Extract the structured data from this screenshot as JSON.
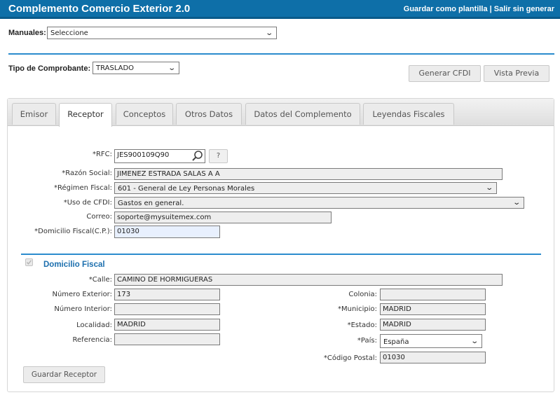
{
  "header": {
    "title": "Complemento Comercio Exterior 2.0",
    "save_template": "Guardar como plantilla",
    "separator": " | ",
    "exit": "Salir sin generar"
  },
  "manuales": {
    "label": "Manuales:",
    "value": "Seleccione"
  },
  "tipo_comprobante": {
    "label": "Tipo de Comprobante:",
    "value": "TRASLADO"
  },
  "actions": {
    "generar": "Generar CFDI",
    "vista_previa": "Vista Previa"
  },
  "tabs": [
    {
      "label": "Emisor",
      "active": false
    },
    {
      "label": "Receptor",
      "active": true
    },
    {
      "label": "Conceptos",
      "active": false
    },
    {
      "label": "Otros Datos",
      "active": false
    },
    {
      "label": "Datos del Complemento",
      "active": false
    },
    {
      "label": "Leyendas Fiscales",
      "active": false
    }
  ],
  "receptor": {
    "rfc": {
      "label": "*RFC:",
      "value": "JES900109Q90"
    },
    "help": "?",
    "razon_social": {
      "label": "*Razón Social:",
      "value": "JIMENEZ ESTRADA SALAS A A"
    },
    "regimen_fiscal": {
      "label": "*Régimen Fiscal:",
      "value": "601 - General de Ley Personas Morales"
    },
    "uso_cfdi": {
      "label": "*Uso de CFDI:",
      "value": "Gastos en general."
    },
    "correo": {
      "label": "Correo:",
      "value": "soporte@mysuitemex.com"
    },
    "domicilio_cp": {
      "label": "*Domicilio Fiscal(C.P.):",
      "value": "01030"
    }
  },
  "domicilio": {
    "heading": "Domicilio Fiscal",
    "checked": true,
    "calle": {
      "label": "*Calle:",
      "value": "CAMINO DE HORMIGUERAS"
    },
    "numero_exterior": {
      "label": "Número Exterior:",
      "value": "173"
    },
    "numero_interior": {
      "label": "Número Interior:",
      "value": ""
    },
    "localidad": {
      "label": "Localidad:",
      "value": "MADRID"
    },
    "referencia": {
      "label": "Referencia:",
      "value": ""
    },
    "colonia": {
      "label": "Colonia:",
      "value": ""
    },
    "municipio": {
      "label": "*Municipio:",
      "value": "MADRID"
    },
    "estado": {
      "label": "*Estado:",
      "value": "MADRID"
    },
    "pais": {
      "label": "*País:",
      "value": "España"
    },
    "codigo_postal": {
      "label": "*Código Postal:",
      "value": "01030"
    }
  },
  "guardar_receptor": "Guardar Receptor",
  "colors": {
    "header_blue": "#0e6fa8",
    "divider_blue": "#2b8ccd",
    "link_blue": "#1c6fae"
  }
}
